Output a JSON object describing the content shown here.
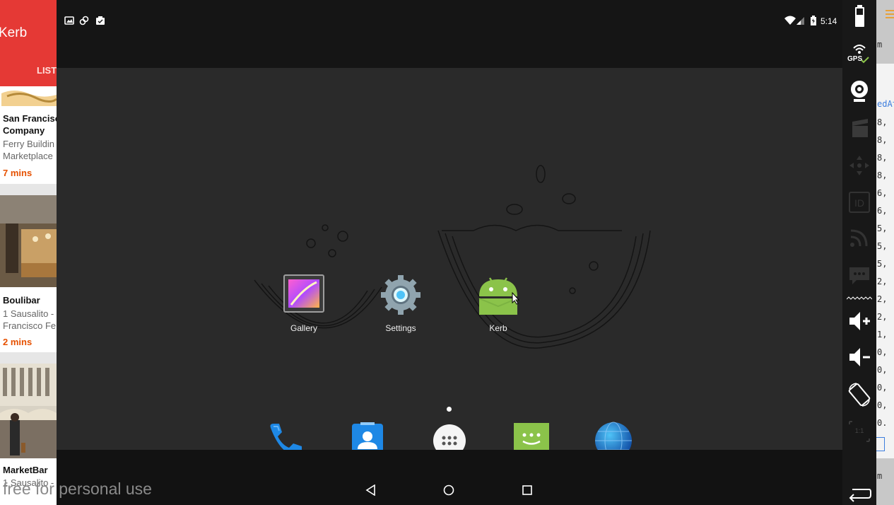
{
  "left_app": {
    "title": "Kerb",
    "tab": "LIST",
    "cards": [
      {
        "name_lines": [
          "San Francisc",
          "Company"
        ],
        "addr_lines": [
          "Ferry Buildin",
          "Marketplace"
        ],
        "eta": "7 mins"
      },
      {
        "name_lines": [
          "Boulibar"
        ],
        "addr_lines": [
          "1 Sausalito -",
          "Francisco Fe"
        ],
        "eta": "2 mins"
      },
      {
        "name_lines": [
          "MarketBar"
        ],
        "addr_lines": [
          "1 Sausalito -"
        ],
        "eta": ""
      }
    ]
  },
  "status_bar": {
    "time": "5:14",
    "left_icons": [
      "gallery-notification-icon",
      "sync-notification-icon",
      "clipboard-notification-icon"
    ],
    "right_icons": [
      "wifi-icon",
      "signal-icon",
      "battery-icon"
    ]
  },
  "home": {
    "apps": [
      {
        "label": "Gallery",
        "icon": "gallery-icon"
      },
      {
        "label": "Settings",
        "icon": "settings-gear-icon"
      },
      {
        "label": "Kerb",
        "icon": "android-robot-icon"
      }
    ],
    "dock": [
      "phone-icon",
      "contacts-icon",
      "app-drawer-icon",
      "messaging-icon",
      "browser-globe-icon"
    ]
  },
  "navbar": {
    "buttons": [
      "back-button",
      "home-button",
      "recents-button"
    ]
  },
  "watermark": "free for personal use",
  "toolbar": {
    "gps_label": "GPS",
    "items": [
      "battery-icon",
      "gps-icon",
      "camera-icon",
      "clapper-icon",
      "dpad-icon",
      "id-icon",
      "rss-icon",
      "sms-icon",
      "volume-up-icon",
      "volume-down-icon",
      "rotate-icon",
      "scale-icon",
      "back-arrow-icon"
    ]
  },
  "code_strip": {
    "lines": [
      "m",
      "edAt",
      "8,",
      "8,",
      "8,",
      "8,",
      "6,",
      "6,",
      "5,",
      "5,",
      "5,",
      "2,",
      "2,",
      "2,",
      "1,",
      "0,",
      "0,",
      "0,",
      "0,",
      "0.",
      "m"
    ]
  },
  "colors": {
    "accent": "#e53935",
    "eta": "#e65100",
    "android_green": "#8bc34a"
  }
}
